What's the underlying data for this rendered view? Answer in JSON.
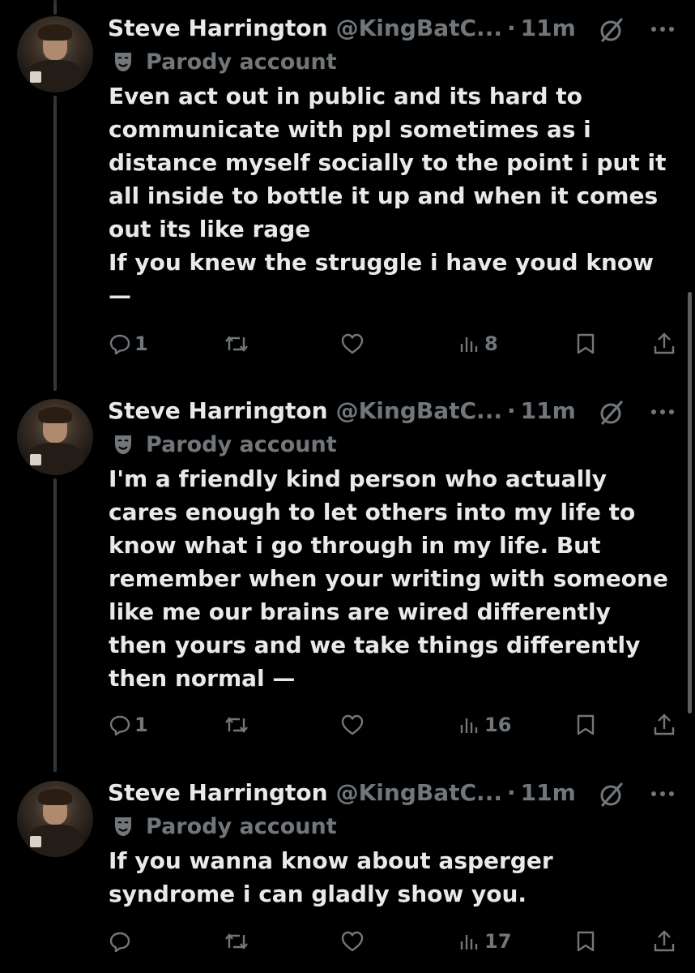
{
  "tweets": [
    {
      "name": "Steve Harrington",
      "handle": "@KingBatC...",
      "sep": "·",
      "time": "11m",
      "label": "Parody account",
      "text": "Even act out in public and its hard to\ncommunicate with ppl sometimes as i\ndistance myself socially to the point i put it\nall inside to bottle it up and when it comes\nout its like rage\nIf you knew the struggle i have youd know\n—",
      "replies": "1",
      "reposts": "",
      "likes": "",
      "views": "8"
    },
    {
      "name": "Steve Harrington",
      "handle": "@KingBatC...",
      "sep": "·",
      "time": "11m",
      "label": "Parody account",
      "text": "I'm a friendly kind person who actually\ncares enough to let others into my life to\nknow what i go through in my life. But\nremember when your writing with someone\nlike me our brains are wired differently\nthen yours and we take things differently\nthen normal —",
      "replies": "1",
      "reposts": "",
      "likes": "",
      "views": "16"
    },
    {
      "name": "Steve Harrington",
      "handle": "@KingBatC...",
      "sep": "·",
      "time": "11m",
      "label": "Parody account",
      "text": "If you wanna know about asperger\nsyndrome i can gladly show you.",
      "replies": "",
      "reposts": "",
      "likes": "",
      "views": "17"
    }
  ],
  "icons": {
    "reply": "reply-icon",
    "repost": "repost-icon",
    "like": "like-icon",
    "views": "views-icon",
    "bookmark": "bookmark-icon",
    "share": "share-icon",
    "grok": "grok-icon",
    "more": "more-icon",
    "parody": "parody-mask-icon"
  },
  "colors": {
    "background": "#000000",
    "text": "#e7e9ea",
    "secondary": "#71767b",
    "thread_line": "#333639"
  }
}
